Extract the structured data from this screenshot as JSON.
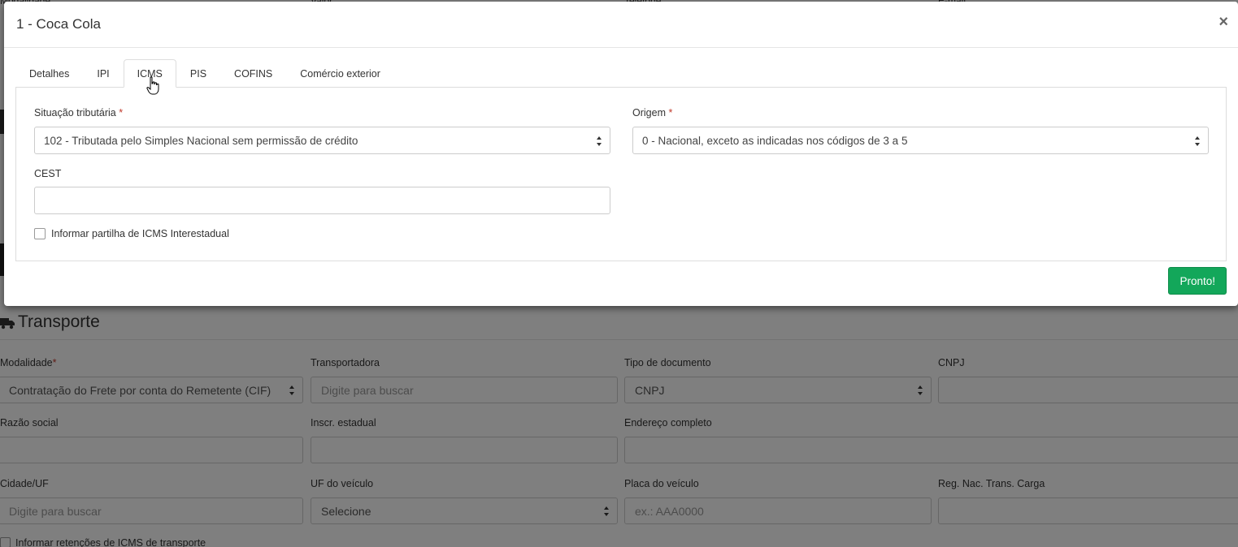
{
  "background": {
    "top_labels": [
      "Modalidade",
      "Valor",
      "Telefone",
      "E-mail"
    ],
    "section_title": "Transporte",
    "fields": {
      "modalidade": {
        "label": "Modalidade",
        "value": "Contratação do Frete por conta do Remetente (CIF)"
      },
      "transportadora": {
        "label": "Transportadora",
        "placeholder": "Digite para buscar"
      },
      "tipo_documento": {
        "label": "Tipo de documento",
        "value": "CNPJ"
      },
      "cnpj": {
        "label": "CNPJ"
      },
      "razao_social": {
        "label": "Razão social"
      },
      "inscr_estadual": {
        "label": "Inscr. estadual"
      },
      "endereco": {
        "label": "Endereço completo"
      },
      "cidade_uf": {
        "label": "Cidade/UF",
        "placeholder": "Digite para buscar"
      },
      "uf_veiculo": {
        "label": "UF do veículo",
        "value": "Selecione"
      },
      "placa": {
        "label": "Placa do veículo",
        "placeholder": "ex.: AAA0000"
      },
      "rntc": {
        "label": "Reg. Nac. Trans. Carga"
      }
    },
    "retencoes_label": "Informar retenções de ICMS de transporte"
  },
  "modal": {
    "title": "1 - Coca Cola",
    "close_label": "×",
    "tabs": [
      {
        "label": "Detalhes",
        "active": false
      },
      {
        "label": "IPI",
        "active": false
      },
      {
        "label": "ICMS",
        "active": true
      },
      {
        "label": "PIS",
        "active": false
      },
      {
        "label": "COFINS",
        "active": false
      },
      {
        "label": "Comércio exterior",
        "active": false
      }
    ],
    "icms": {
      "situacao_label": "Situação tributária",
      "situacao_value": "102 - Tributada pelo Simples Nacional sem permissão de crédito",
      "origem_label": "Origem",
      "origem_value": "0 - Nacional, exceto as indicadas nos códigos de 3 a 5",
      "cest_label": "CEST",
      "cest_value": "",
      "partilha_label": "Informar partilha de ICMS Interestadual",
      "required_mark": "*"
    },
    "done_label": "Pronto!"
  },
  "colors": {
    "primary_button": "#13a75a",
    "required": "#c0392b",
    "overlay": "rgba(0,0,0,0.5)"
  }
}
